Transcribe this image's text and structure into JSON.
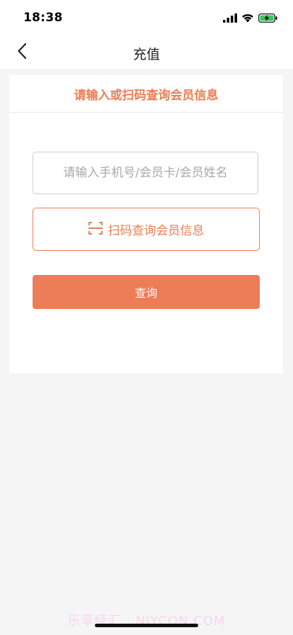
{
  "status_bar": {
    "time": "18:38"
  },
  "nav": {
    "title": "充值"
  },
  "card": {
    "title": "请输入或扫码查询会员信息",
    "search": {
      "placeholder": "请输入手机号/会员卡/会员姓名",
      "value": ""
    },
    "scan_label": "扫码查询会员信息",
    "query_label": "查询"
  },
  "watermark": "乐享经汇 · NIYCON.COM",
  "colors": {
    "accent": "#ec7d54",
    "button": "#ed7d57",
    "background": "#f5f5f5"
  },
  "icons": [
    "back-chevron-icon",
    "signal-icon",
    "wifi-icon",
    "battery-charging-icon",
    "scan-icon"
  ]
}
